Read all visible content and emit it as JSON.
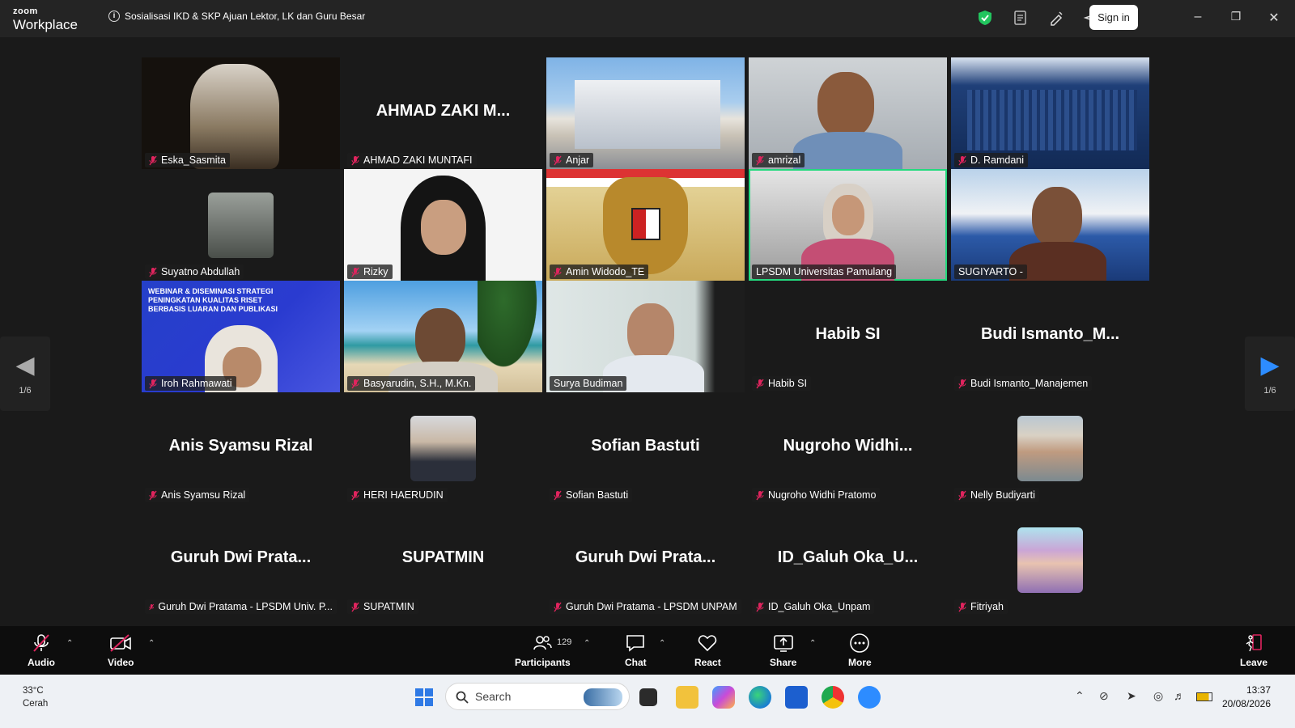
{
  "window": {
    "brand_small": "zoom",
    "brand_large": "Workplace",
    "meeting_title": "Sosialisasi IKD & SKP Ajuan Lektor, LK dan Guru Besar",
    "sign_in_label": "Sign in",
    "accent_color": "#23d97d"
  },
  "pager": {
    "left_label": "1/6",
    "right_label": "1/6"
  },
  "tiles": [
    {
      "name": "Eska_Sasmita"
    },
    {
      "name": "AHMAD ZAKI MUNTAFI",
      "display": "AHMAD ZAKI M..."
    },
    {
      "name": "Anjar"
    },
    {
      "name": "amrizal"
    },
    {
      "name": "D. Ramdani"
    },
    {
      "name": "Suyatno Abdullah"
    },
    {
      "name": "Rizky"
    },
    {
      "name": "Amin Widodo_TE"
    },
    {
      "name": "LPSDM Universitas Pamulang"
    },
    {
      "name": "SUGIYARTO -"
    },
    {
      "name": "Iroh Rahmawati",
      "banner": "WEBINAR & DISEMINASI STRATEGI PENINGKATAN KUALITAS RISET BERBASIS LUARAN DAN PUBLIKASI"
    },
    {
      "name": "Basyarudin, S.H., M.Kn."
    },
    {
      "name": "Surya Budiman"
    },
    {
      "name": "Habib SI",
      "display": "Habib SI"
    },
    {
      "name": "Budi Ismanto_Manajemen",
      "display": "Budi  Ismanto_M..."
    },
    {
      "name": "Anis Syamsu Rizal",
      "display": "Anis Syamsu Rizal"
    },
    {
      "name": "HERI HAERUDIN"
    },
    {
      "name": "Sofian Bastuti",
      "display": "Sofian Bastuti"
    },
    {
      "name": "Nugroho Widhi Pratomo",
      "display": "Nugroho  Widhi..."
    },
    {
      "name": "Nelly Budiyarti"
    },
    {
      "name": "Guruh Dwi Pratama - LPSDM Univ. P...",
      "display": "Guruh  Dwi  Prata..."
    },
    {
      "name": "SUPATMIN",
      "display": "SUPATMIN"
    },
    {
      "name": "Guruh Dwi Pratama - LPSDM UNPAM",
      "display": "Guruh  Dwi  Prata..."
    },
    {
      "name": "ID_Galuh Oka_Unpam",
      "display": "ID_Galuh  Oka_U..."
    },
    {
      "name": "Fitriyah"
    }
  ],
  "toolbar": {
    "audio": "Audio",
    "video": "Video",
    "participants": "Participants",
    "participants_count": "129",
    "chat": "Chat",
    "react": "React",
    "share": "Share",
    "more": "More",
    "leave": "Leave"
  },
  "taskbar": {
    "temperature": "33°C",
    "weather": "Cerah",
    "search_placeholder": "Search",
    "time": "13:37",
    "date": "20/08/2026"
  }
}
